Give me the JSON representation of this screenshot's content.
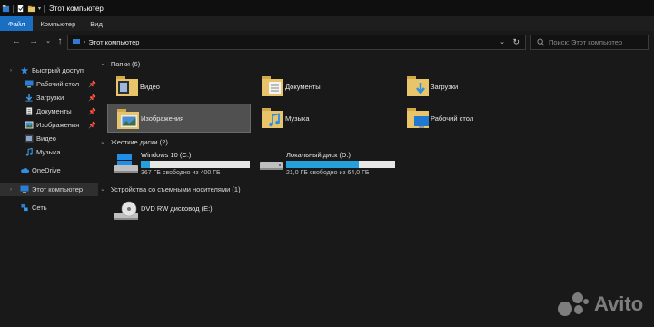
{
  "window": {
    "title": "Этот компьютер"
  },
  "ribbon": {
    "tabs": [
      "Файл",
      "Компьютер",
      "Вид"
    ]
  },
  "address": {
    "path": "Этот компьютер",
    "search_placeholder": "Поиск: Этот компьютер"
  },
  "sidebar": {
    "items": [
      {
        "label": "Быстрый доступ",
        "icon": "star-icon",
        "pinned": false
      },
      {
        "label": "Рабочий стол",
        "icon": "desktop-icon",
        "pinned": true
      },
      {
        "label": "Загрузки",
        "icon": "download-icon",
        "pinned": true
      },
      {
        "label": "Документы",
        "icon": "documents-icon",
        "pinned": true
      },
      {
        "label": "Изображения",
        "icon": "pictures-icon",
        "pinned": true
      },
      {
        "label": "Видео",
        "icon": "video-icon",
        "pinned": false
      },
      {
        "label": "Музыка",
        "icon": "music-icon",
        "pinned": false
      },
      {
        "label": "OneDrive",
        "icon": "cloud-icon",
        "pinned": false
      },
      {
        "label": "Этот компьютер",
        "icon": "computer-icon",
        "pinned": false,
        "selected": true
      },
      {
        "label": "Сеть",
        "icon": "network-icon",
        "pinned": false
      }
    ]
  },
  "main": {
    "folders_header": "Папки (6)",
    "folders": [
      {
        "label": "Видео",
        "icon": "video-folder-icon"
      },
      {
        "label": "Документы",
        "icon": "documents-folder-icon"
      },
      {
        "label": "Загрузки",
        "icon": "downloads-folder-icon"
      },
      {
        "label": "Изображения",
        "icon": "pictures-folder-icon",
        "selected": true
      },
      {
        "label": "Музыка",
        "icon": "music-folder-icon"
      },
      {
        "label": "Рабочий стол",
        "icon": "desktop-folder-icon"
      }
    ],
    "drives_header": "Жесткие диски (2)",
    "drives": [
      {
        "name": "Windows 10 (C:)",
        "free_text": "367 ГБ свободно из 400 ГБ",
        "used_fraction": 0.08,
        "icon": "windows-drive-icon"
      },
      {
        "name": "Локальный диск (D:)",
        "free_text": "21,0 ГБ свободно из 64,0 ГБ",
        "used_fraction": 0.67,
        "icon": "hard-drive-icon"
      }
    ],
    "removable_header": "Устройства со съемными носителями (1)",
    "removable": [
      {
        "name": "DVD RW дисковод (E:)",
        "icon": "dvd-drive-icon"
      }
    ]
  },
  "watermark": {
    "text": "Avito"
  },
  "colors": {
    "accent": "#1a6fc2",
    "bar_fill": "#26a0da",
    "folder": "#e8c46a",
    "selection": "#505050"
  }
}
